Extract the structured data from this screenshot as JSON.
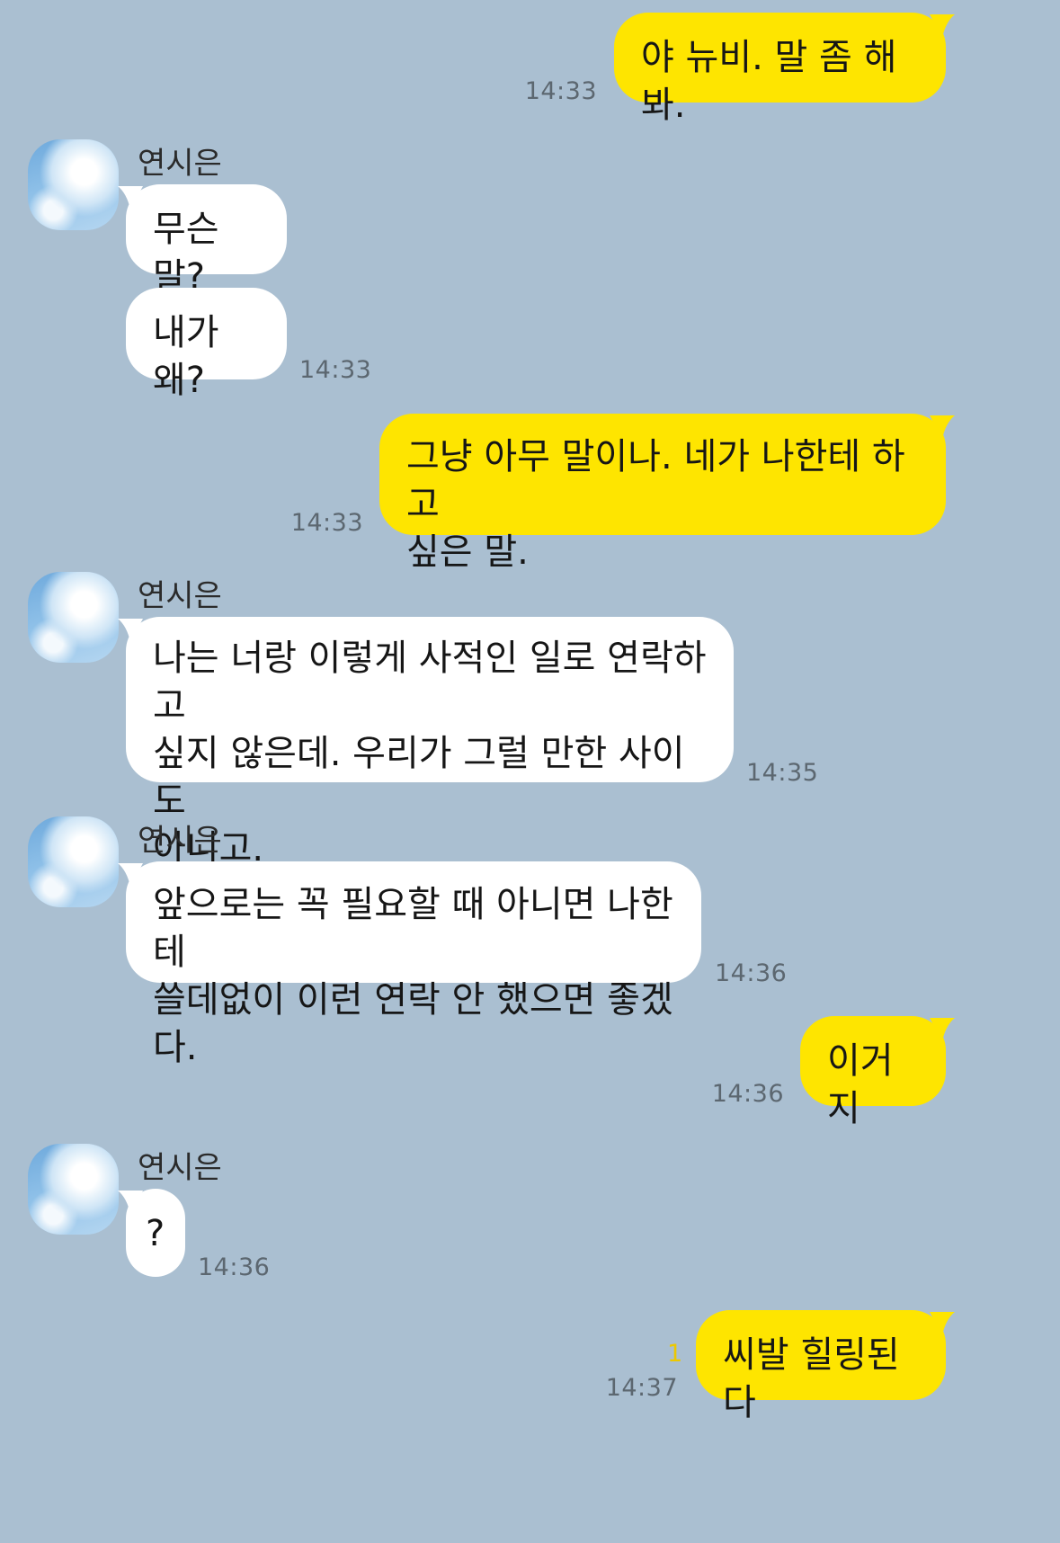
{
  "colors": {
    "background": "#aabfd1",
    "my_bubble": "#fee500",
    "their_bubble": "#ffffff",
    "unread": "#ecc800"
  },
  "contact": {
    "name": "연시은",
    "avatar_icon": "sky-avatar-icon"
  },
  "messages": [
    {
      "sender": "me",
      "text": "야 뉴비. 말 좀 해봐.",
      "time": "14:33"
    },
    {
      "sender": "them",
      "text": "무슨 말?"
    },
    {
      "sender": "them",
      "text": "내가 왜?",
      "time": "14:33"
    },
    {
      "sender": "me",
      "text": "그냥 아무 말이나. 네가 나한테 하고\n싶은 말.",
      "time": "14:33"
    },
    {
      "sender": "them",
      "text": "나는 너랑 이렇게 사적인 일로 연락하고\n싶지 않은데. 우리가 그럴 만한 사이도\n아니고.",
      "time": "14:35"
    },
    {
      "sender": "them",
      "text": "앞으로는 꼭 필요할 때 아니면 나한테\n쓸데없이 이런 연락 안 했으면 좋겠다.",
      "time": "14:36"
    },
    {
      "sender": "me",
      "text": "이거지",
      "time": "14:36"
    },
    {
      "sender": "them",
      "text": "?",
      "time": "14:36"
    },
    {
      "sender": "me",
      "text": "씨발 힐링된다",
      "time": "14:37",
      "unread": "1"
    }
  ]
}
